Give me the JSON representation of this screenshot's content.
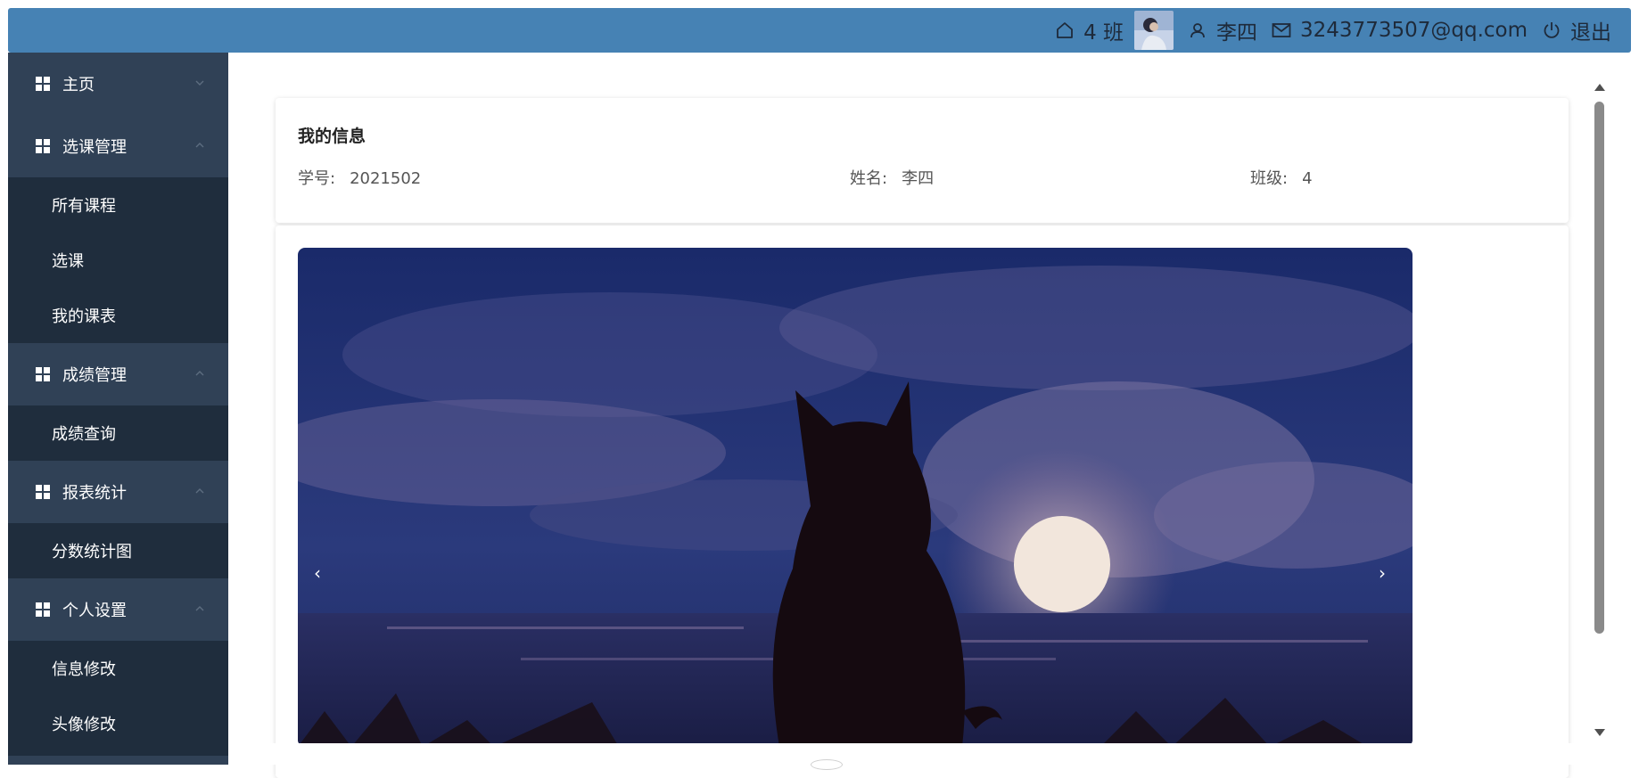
{
  "header": {
    "class_label": "4 班",
    "user_name": "李四",
    "email": "3243773507@qq.com",
    "logout": "退出",
    "brand_color": "#4682b4",
    "icons": [
      "home-icon",
      "avatar",
      "user-icon",
      "mail-icon",
      "power-icon"
    ]
  },
  "sidebar": {
    "colors": {
      "submenu_bg": "#304156",
      "item_bg": "#1f2d3d",
      "text": "#ffffff"
    },
    "menus": [
      {
        "label": "主页",
        "icon": "grid-icon",
        "items": []
      },
      {
        "label": "选课管理",
        "icon": "grid-icon",
        "items": [
          "所有课程",
          "选课",
          "我的课表"
        ]
      },
      {
        "label": "成绩管理",
        "icon": "grid-icon",
        "items": [
          "成绩查询"
        ]
      },
      {
        "label": "报表统计",
        "icon": "grid-icon",
        "items": [
          "分数统计图"
        ]
      },
      {
        "label": "个人设置",
        "icon": "grid-icon",
        "items": [
          "信息修改",
          "头像修改"
        ]
      }
    ]
  },
  "info": {
    "title": "我的信息",
    "student_id_label": "学号:",
    "student_id": "2021502",
    "name_label": "姓名:",
    "name": "李四",
    "class_label": "班级:",
    "class": "4"
  },
  "carousel": {
    "prev_icon": "chevron-left-icon",
    "next_icon": "chevron-right-icon",
    "prev_glyph": "‹",
    "next_glyph": "›"
  }
}
